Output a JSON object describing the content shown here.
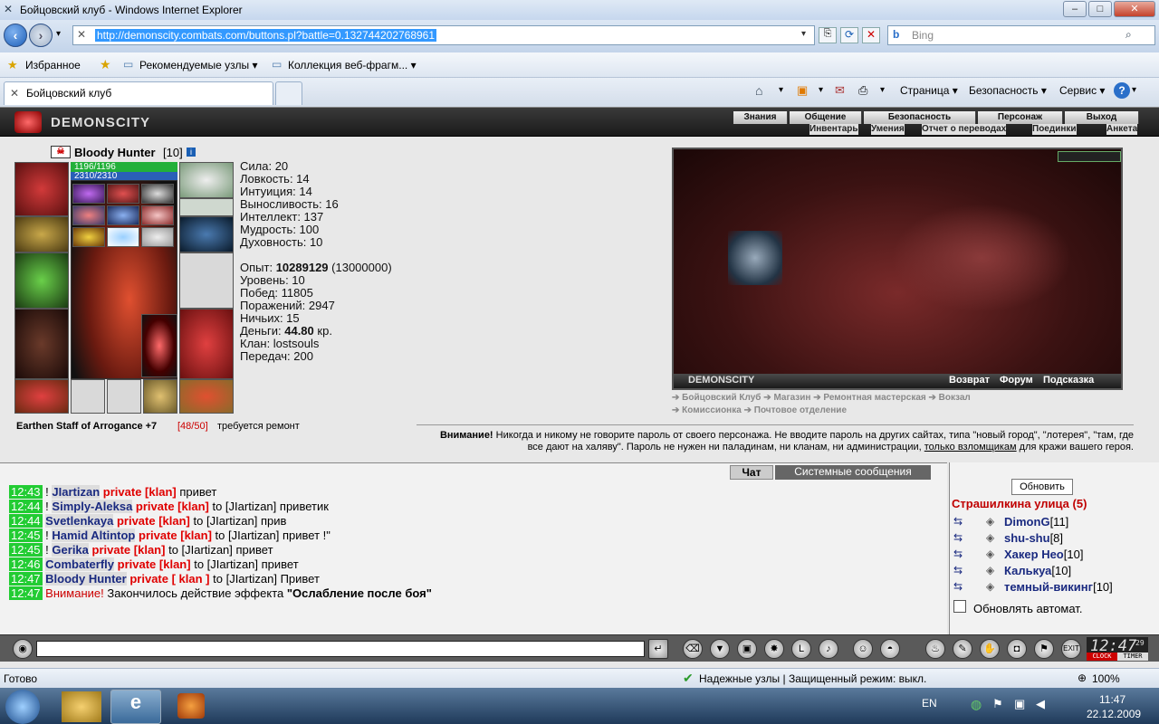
{
  "window": {
    "title": "Бойцовский клуб - Windows Internet Explorer"
  },
  "address": {
    "url": "http://demonscity.combats.com/buttons.pl?battle=0.132744202768961",
    "search_placeholder": "Bing"
  },
  "favorites": {
    "label": "Избранное",
    "items": [
      "Рекомендуемые узлы ▾",
      "Коллекция веб-фрагм... ▾"
    ]
  },
  "tab": {
    "title": "Бойцовский клуб"
  },
  "commandbar": {
    "page": "Страница ▾",
    "security": "Безопасность ▾",
    "service": "Сервис ▾"
  },
  "game": {
    "logo": "DEMONSCITY",
    "menu_top": [
      "Знания",
      "Общение",
      "Безопасность",
      "Персонаж",
      "Выход"
    ],
    "menu_sub": [
      "Инвентарь",
      "Умения",
      "Отчет о переводах",
      "Поединки",
      "Анкета"
    ],
    "character": {
      "name": "Bloody Hunter",
      "level": "[10]",
      "hp": "1196/1196",
      "mana": "2310/2310",
      "stats": [
        "Сила: 20",
        "Ловкость: 14",
        "Интуиция: 14",
        "Выносливость: 16",
        "Интеллект: 137",
        "Мудрость: 100",
        "Духовность: 10"
      ],
      "exp_label": "Опыт:",
      "exp_value": "10289129",
      "exp_next": "(13000000)",
      "info": [
        "Уровень: 10",
        "Побед: 11805",
        "Поражений: 2947",
        "Ничьих: 15"
      ],
      "money_label": "Деньги:",
      "money_value": "44.80",
      "money_unit": "кр.",
      "clan": "Клан: lostsouls",
      "transfers": "Передач: 200",
      "item_name": "Earthen Staff of Arrogance +7",
      "item_durability": "[48/50]",
      "item_note": "требуется ремонт"
    },
    "scene": {
      "caption": "DEMONSCITY",
      "links": [
        "Возврат",
        "Форум",
        "Подсказка"
      ],
      "nav": [
        "Бойцовский Клуб",
        "Магазин",
        "Ремонтная мастерская",
        "Вокзал",
        "Комиссионка",
        "Почтовое отделение"
      ]
    },
    "warning": {
      "bold": "Внимание!",
      "text": "Никогда и никому не говорите пароль от своего персонажа. Не вводите пароль на других сайтах, типа \"новый город\", \"лотерея\", \"там, где все дают на халяву\". Пароль не нужен ни паладинам, ни кланам, ни администрации,",
      "link": "только взломщикам",
      "tail": "для кражи вашего героя."
    },
    "chat_tabs": [
      "Чат",
      "Системные сообщения"
    ],
    "chat": [
      {
        "time": "12:43",
        "pre": "!",
        "name": "JIartizan",
        "tag": "private [klan]",
        "to": "",
        "msg": "привет"
      },
      {
        "time": "12:44",
        "pre": "!",
        "name": "Simply-Aleksa",
        "tag": "private [klan]",
        "to": "to [JIartizan]",
        "msg": "приветик"
      },
      {
        "time": "12:44",
        "pre": "",
        "name": "Svetlenkaya",
        "tag": "private [klan]",
        "to": "to [JIartizan]",
        "msg": "прив"
      },
      {
        "time": "12:45",
        "pre": "!",
        "name": "Hamid Altintop",
        "tag": "private [klan]",
        "to": "to [JIartizan]",
        "msg": "привет !\""
      },
      {
        "time": "12:45",
        "pre": "!",
        "name": "Gerika",
        "tag": "private [klan]",
        "to": "to [JIartizan]",
        "msg": "привет"
      },
      {
        "time": "12:46",
        "pre": "",
        "name": "Combaterfly",
        "tag": "private [klan]",
        "to": "to [JIartizan]",
        "msg": "привет"
      },
      {
        "time": "12:47",
        "pre": "",
        "name": "Bloody Hunter",
        "tag": "private [ klan ]",
        "to": "to [JIartizan]",
        "msg": "Привет"
      }
    ],
    "system_msg": {
      "time": "12:47",
      "label": "Внимание!",
      "text": "Закончилось действие эффекта",
      "effect": "\"Ослабление после боя\""
    },
    "online": {
      "refresh": "Обновить",
      "location": "Страшилкина улица (5)",
      "players": [
        {
          "name": "DimonG",
          "level": "[11]"
        },
        {
          "name": "shu-shu",
          "level": "[8]"
        },
        {
          "name": "Хакер Нео",
          "level": "[10]"
        },
        {
          "name": "Калькуа",
          "level": "[10]"
        },
        {
          "name": "темный-викинг",
          "level": "[10]"
        }
      ],
      "auto": "Обновлять автомат."
    },
    "clock": "12:47",
    "clock_sec": "29",
    "clock_labels": [
      "CLOCK",
      "TIMER"
    ]
  },
  "status": {
    "left": "Готово",
    "zone": "Надежные узлы | Защищенный режим: выкл.",
    "zoom": "100%"
  },
  "taskbar": {
    "lang": "EN",
    "time": "11:47",
    "date": "22.12.2009"
  }
}
